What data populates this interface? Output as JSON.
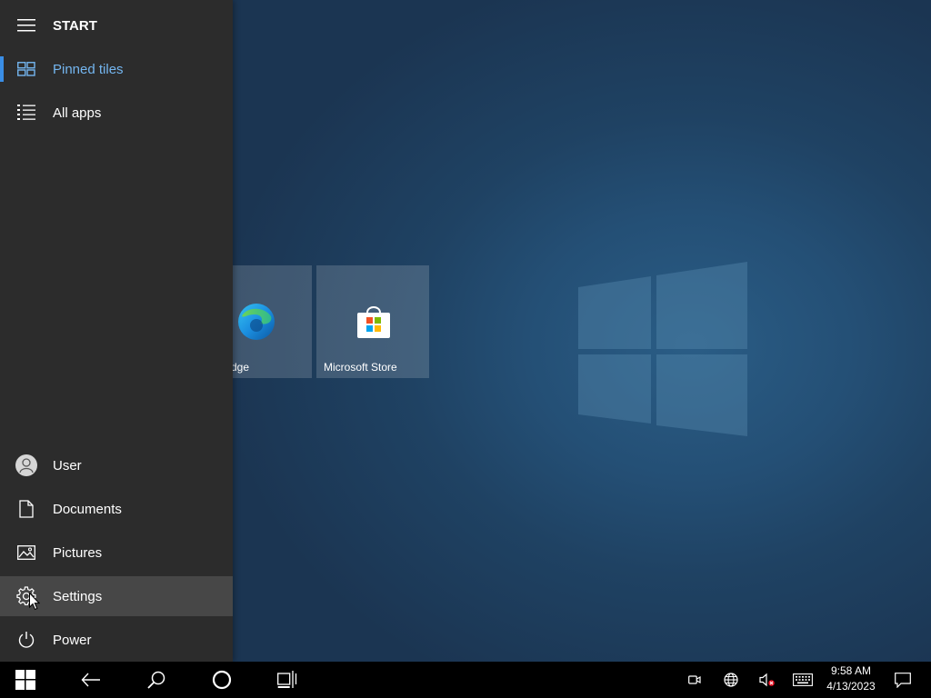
{
  "start": {
    "header_label": "START",
    "nav": [
      {
        "label": "Pinned tiles",
        "icon": "pinned-tiles-icon",
        "active": true
      },
      {
        "label": "All apps",
        "icon": "all-apps-icon",
        "active": false
      }
    ],
    "bottom": [
      {
        "label": "User",
        "icon": "user-avatar-icon"
      },
      {
        "label": "Documents",
        "icon": "document-icon"
      },
      {
        "label": "Pictures",
        "icon": "pictures-icon"
      },
      {
        "label": "Settings",
        "icon": "gear-icon",
        "hovered": true
      },
      {
        "label": "Power",
        "icon": "power-icon"
      }
    ],
    "accent_color": "#3a8ee6"
  },
  "tiles": [
    {
      "label": "Microsoft Edge",
      "icon": "edge-icon"
    },
    {
      "label": "Microsoft Store",
      "icon": "store-icon"
    }
  ],
  "taskbar": {
    "buttons": [
      "windows-start-icon",
      "back-arrow-icon",
      "search-icon",
      "cortana-circle-icon",
      "task-view-icon"
    ],
    "tray": [
      "meet-now-icon",
      "network-globe-icon",
      "volume-muted-icon",
      "keyboard-icon",
      "notification-icon"
    ],
    "clock": {
      "time": "9:58 AM",
      "date": "4/13/2023"
    }
  }
}
